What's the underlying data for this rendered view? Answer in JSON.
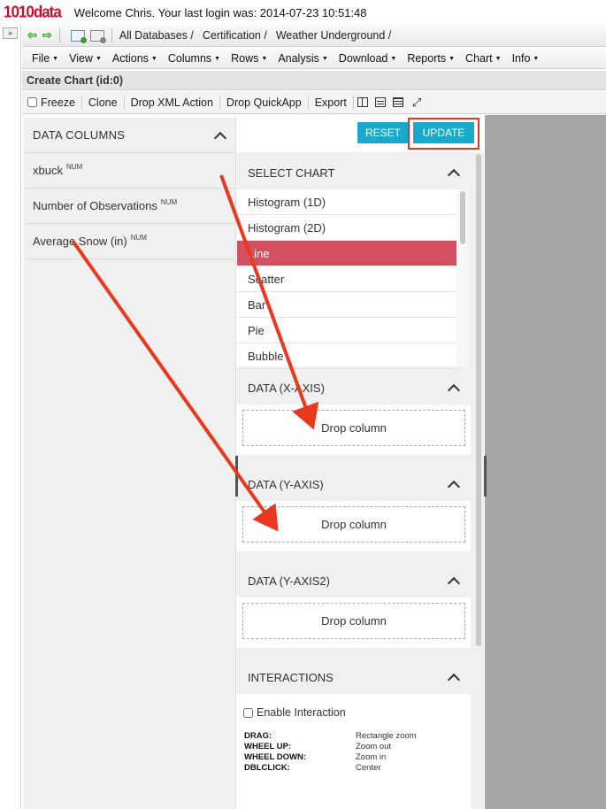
{
  "header": {
    "logo": "1010data",
    "welcome": "Welcome Chris. Your last login was: 2014-07-23 10:51:48"
  },
  "collapse_label": "»",
  "breadcrumbs": [
    "All Databases /",
    "Certification /",
    "Weather Underground /"
  ],
  "menu": [
    "File",
    "View",
    "Actions",
    "Columns",
    "Rows",
    "Analysis",
    "Download",
    "Reports",
    "Chart",
    "Info"
  ],
  "window_title": "Create Chart (id:0)",
  "actions": {
    "freeze": "Freeze",
    "clone": "Clone",
    "drop_xml": "Drop XML Action",
    "drop_quickapp": "Drop QuickApp",
    "export": "Export"
  },
  "data_columns": {
    "title": "DATA COLUMNS",
    "items": [
      {
        "name": "xbuck",
        "type": "NUM"
      },
      {
        "name": "Number of Observations",
        "type": "NUM"
      },
      {
        "name": "Average Snow (in)",
        "type": "NUM"
      }
    ]
  },
  "buttons": {
    "reset": "RESET",
    "update": "UPDATE"
  },
  "select_chart": {
    "title": "SELECT CHART",
    "options": [
      "Histogram (1D)",
      "Histogram (2D)",
      "Line",
      "Scatter",
      "Bar",
      "Pie",
      "Bubble"
    ],
    "selected": "Line"
  },
  "axes": [
    {
      "title": "DATA (X-AXIS)",
      "drop": "Drop column"
    },
    {
      "title": "DATA (Y-AXIS)",
      "drop": "Drop column"
    },
    {
      "title": "DATA (Y-AXIS2)",
      "drop": "Drop column"
    }
  ],
  "interactions": {
    "title": "INTERACTIONS",
    "enable": "Enable Interaction",
    "bindings": [
      {
        "key": "DRAG:",
        "value": "Rectangle zoom"
      },
      {
        "key": "WHEEL UP:",
        "value": "Zoom out"
      },
      {
        "key": "WHEEL DOWN:",
        "value": "Zoom in"
      },
      {
        "key": "DBLCLICK:",
        "value": "Center"
      }
    ]
  },
  "colors": {
    "accent": "#1aa9c9",
    "selected": "#d35060",
    "annotation": "#e23a1f"
  }
}
